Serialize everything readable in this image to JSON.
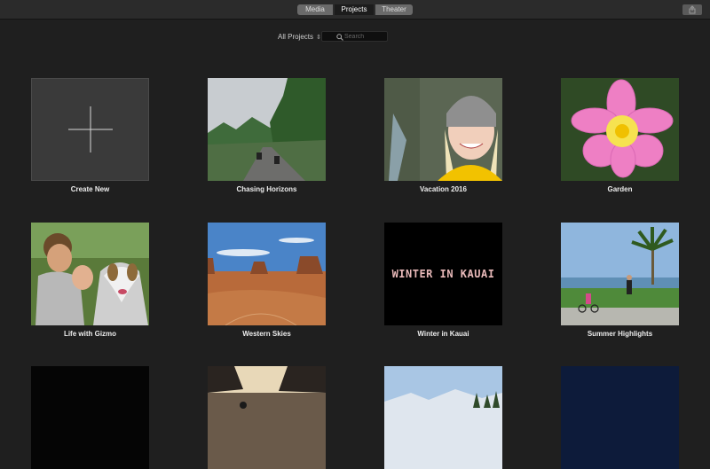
{
  "toolbar": {
    "tabs": [
      {
        "label": "Media"
      },
      {
        "label": "Projects"
      },
      {
        "label": "Theater"
      }
    ],
    "share_icon": "share-icon"
  },
  "filter": {
    "label": "All Projects"
  },
  "search": {
    "placeholder": "Search",
    "icon": "search-icon"
  },
  "projects": [
    {
      "title": "Create New"
    },
    {
      "title": "Chasing Horizons"
    },
    {
      "title": "Vacation 2016"
    },
    {
      "title": "Garden"
    },
    {
      "title": "Life with Gizmo"
    },
    {
      "title": "Western Skies"
    },
    {
      "title": "Winter in Kauai",
      "thumbnail_text": "WINTER IN KAUAI"
    },
    {
      "title": "Summer Highlights"
    }
  ],
  "colors": {
    "background": "#1f1f1f",
    "toolbar": "#2b2b2b",
    "segment": "#6a6a6a",
    "segment_selected": "#1c1c1c"
  }
}
